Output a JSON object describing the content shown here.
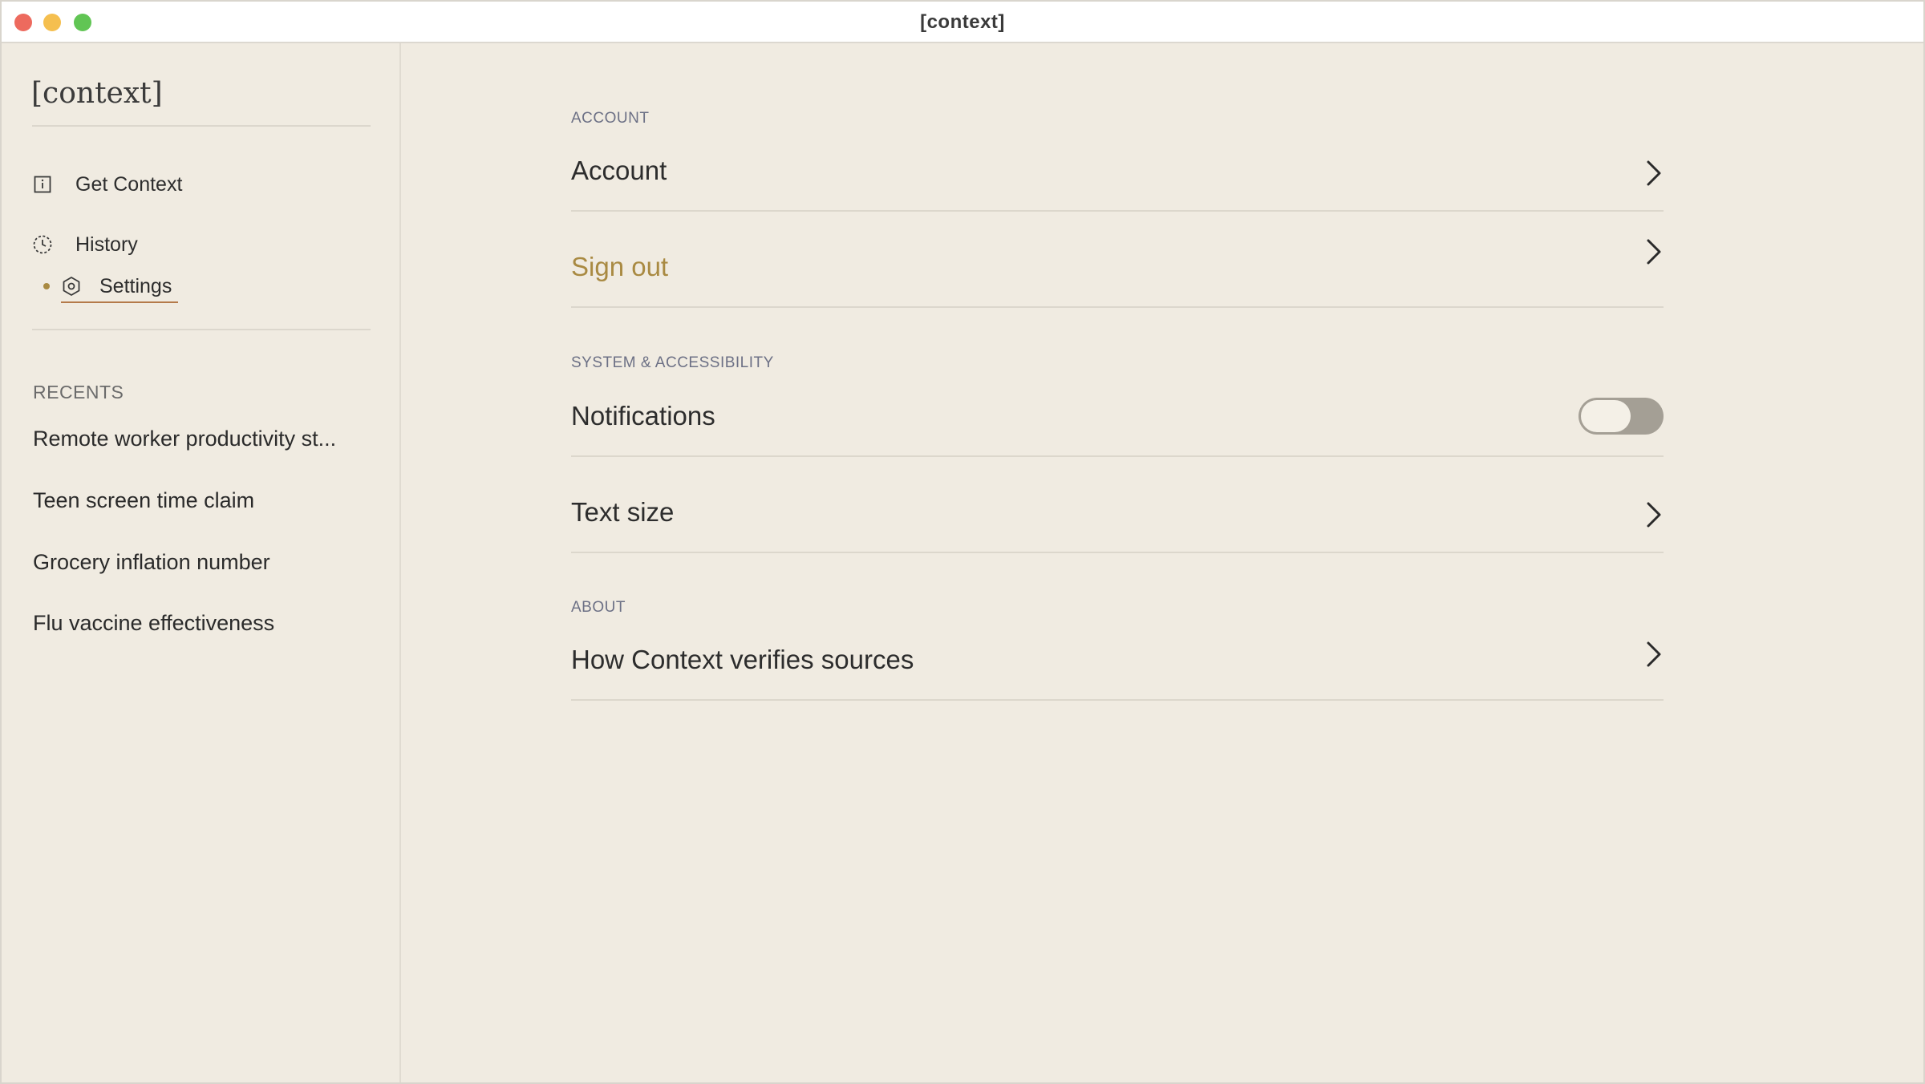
{
  "window": {
    "title": "[context]"
  },
  "sidebar": {
    "brand": "[context]",
    "nav": [
      {
        "label": "Get Context",
        "icon": "info-square-icon"
      },
      {
        "label": "History",
        "icon": "clock-icon"
      },
      {
        "label": "Settings",
        "icon": "gear-icon",
        "active": true
      }
    ],
    "recents_label": "RECENTS",
    "recents": [
      "Remote worker productivity st...",
      "Teen screen time claim",
      "Grocery inflation number",
      "Flu vaccine effectiveness"
    ]
  },
  "settings": {
    "account_section": "ACCOUNT",
    "account": "Account",
    "sign_out": "Sign out",
    "system_section": "SYSTEM & ACCESSIBILITY",
    "notifications": "Notifications",
    "notifications_enabled": false,
    "text_size": "Text size",
    "about_section": "ABOUT",
    "how_verifies": "How Context verifies sources"
  },
  "colors": {
    "background": "#f0ebe1",
    "accent_gold": "#a98a42",
    "toggle_off": "#a49f95"
  }
}
